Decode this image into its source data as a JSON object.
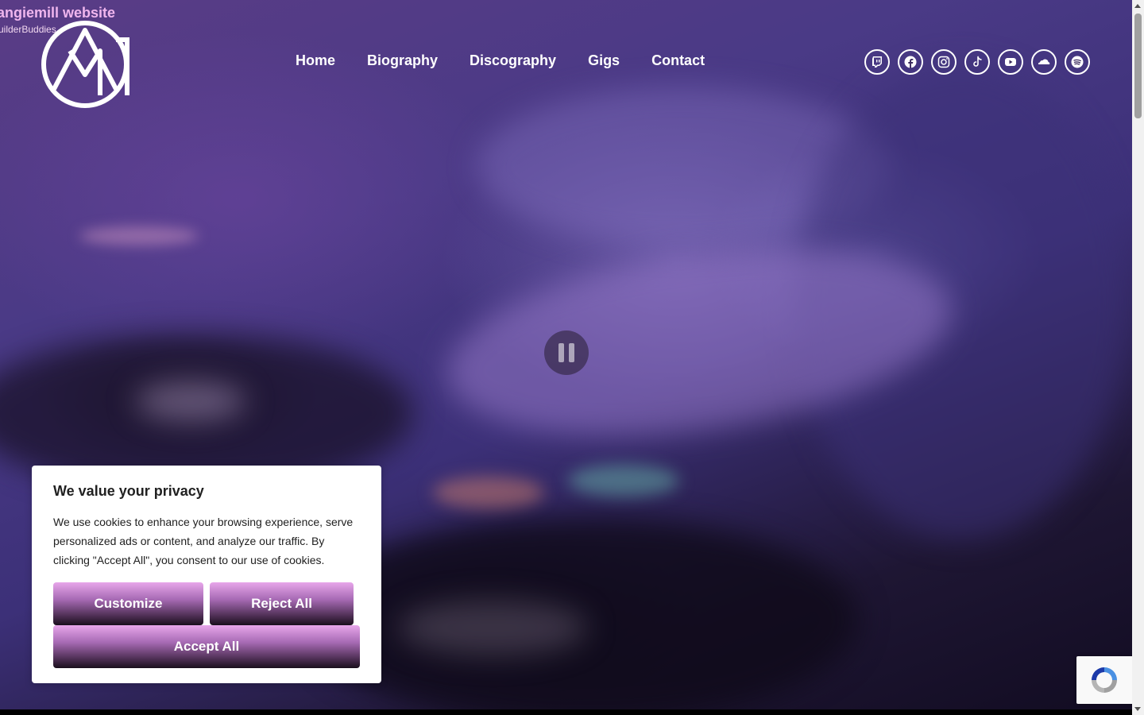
{
  "site": {
    "title": "angiemill website",
    "tagline": "uilderBuddies"
  },
  "nav": {
    "items": [
      {
        "label": "Home"
      },
      {
        "label": "Biography"
      },
      {
        "label": "Discography"
      },
      {
        "label": "Gigs"
      },
      {
        "label": "Contact"
      }
    ]
  },
  "social": [
    {
      "icon": "twitch-icon"
    },
    {
      "icon": "facebook-icon"
    },
    {
      "icon": "instagram-icon"
    },
    {
      "icon": "tiktok-icon"
    },
    {
      "icon": "youtube-icon"
    },
    {
      "icon": "soundcloud-icon"
    },
    {
      "icon": "spotify-icon"
    }
  ],
  "video": {
    "control_icon": "pause-icon"
  },
  "cookie_banner": {
    "title": "We value your privacy",
    "body": "We use cookies to enhance your browsing experience, serve personalized ads or content, and analyze our traffic. By clicking \"Accept All\", you consent to our use of cookies.",
    "customize_label": "Customize",
    "reject_label": "Reject All",
    "accept_label": "Accept All"
  },
  "colors": {
    "accent_pink": "#f0b6ee",
    "button_gradient_top": "#e7a6ea",
    "button_gradient_bottom": "#1a0f1c"
  }
}
